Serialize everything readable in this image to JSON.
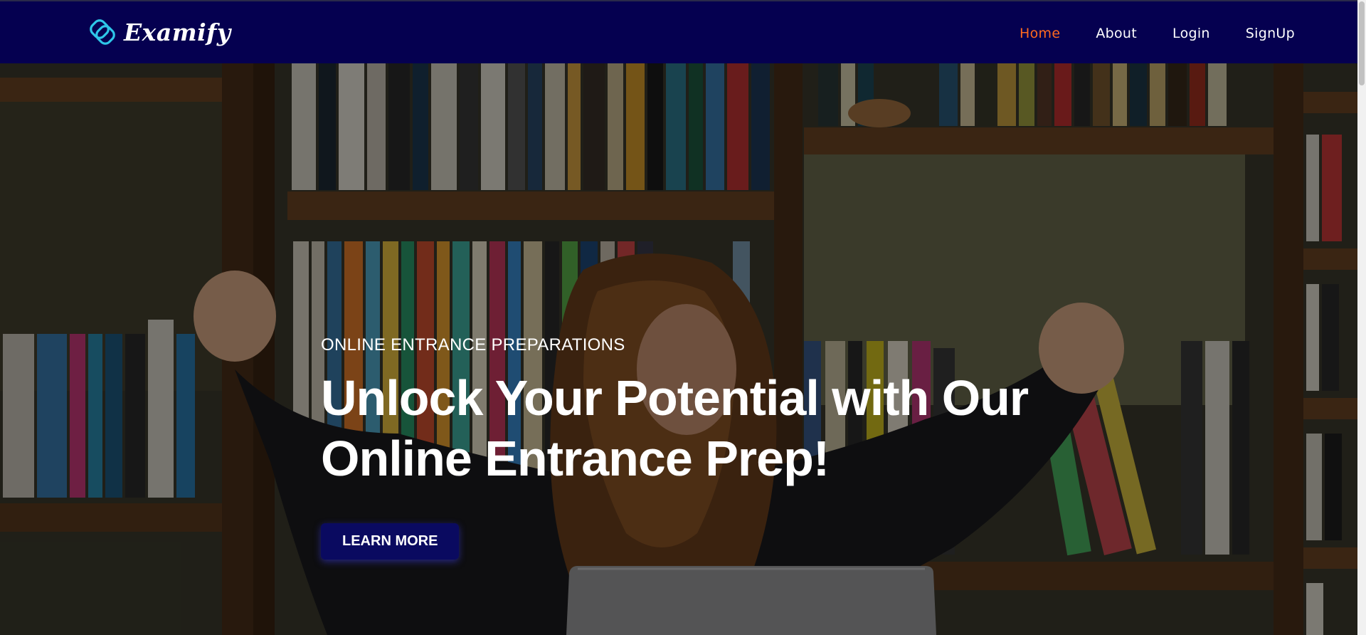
{
  "brand": {
    "name": "Examify",
    "logo_icon": "intertwined-rings-icon",
    "accent_color": "#ff6a1f",
    "nav_bg_color": "#050050",
    "button_color": "#0a0a60"
  },
  "nav": {
    "items": [
      {
        "label": "Home",
        "active": true
      },
      {
        "label": "About",
        "active": false
      },
      {
        "label": "Login",
        "active": false
      },
      {
        "label": "SignUp",
        "active": false
      }
    ]
  },
  "hero": {
    "subtitle": "ONLINE ENTRANCE PREPARATIONS",
    "title_line1": "Unlock Your Potential with Our",
    "title_line2": "Online Entrance Prep!",
    "cta_label": "LEARN MORE",
    "background": "celebrating-student-bookshelf-photo"
  }
}
